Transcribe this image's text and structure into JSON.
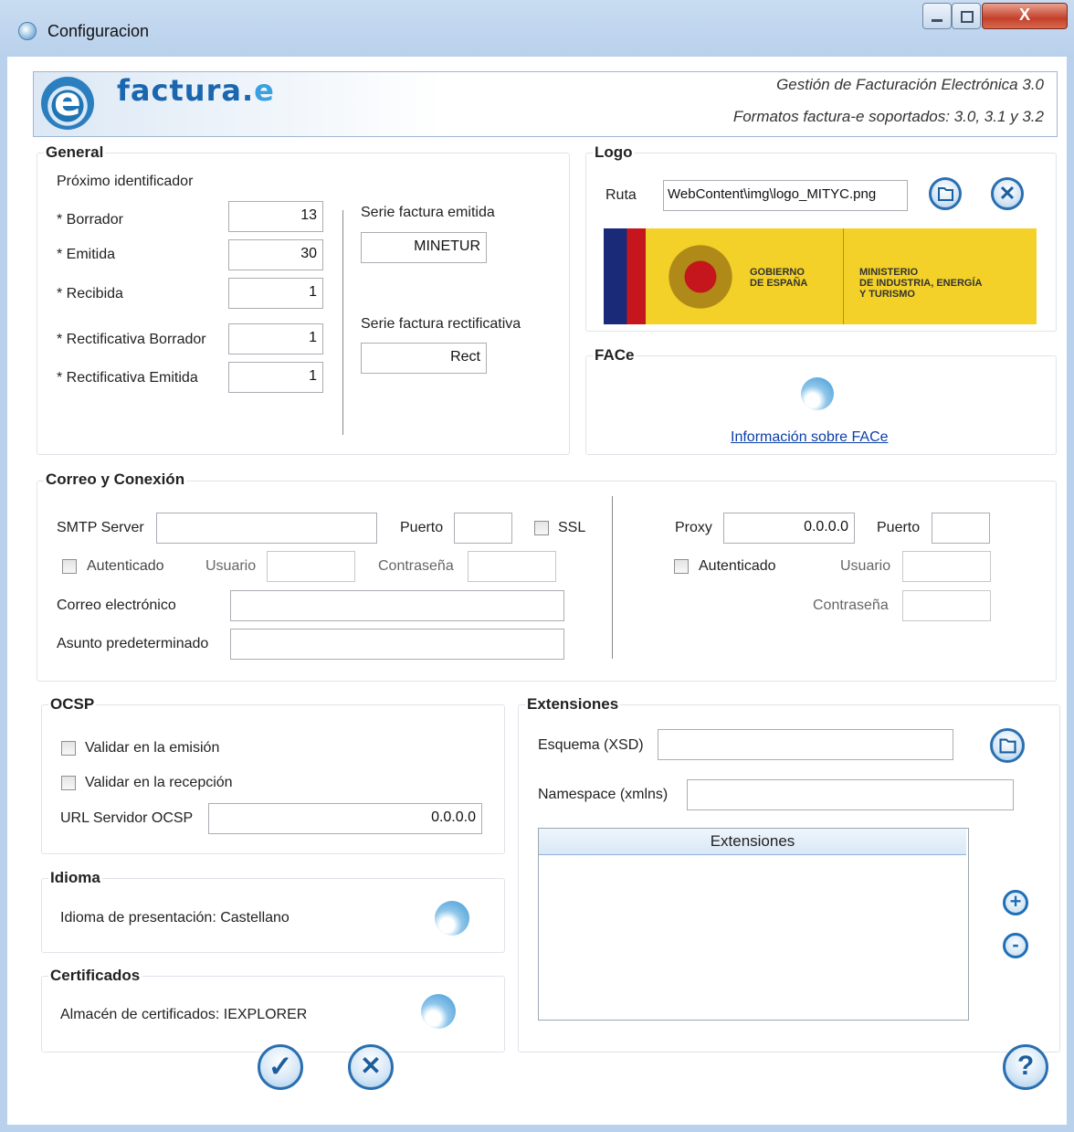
{
  "window": {
    "title": "Configuracion",
    "close_label": "X"
  },
  "header": {
    "brand_prefix": "factura.",
    "brand_suffix": "e",
    "line1": "Gestión de Facturación Electrónica 3.0",
    "line2": "Formatos factura-e soportados: 3.0, 3.1 y 3.2"
  },
  "general": {
    "title": "General",
    "next_id_label": "Próximo identificador",
    "borrador_label": "* Borrador",
    "borrador_value": "13",
    "emitida_label": "* Emitida",
    "emitida_value": "30",
    "recibida_label": "* Recibida",
    "recibida_value": "1",
    "rect_borrador_label": "* Rectificativa Borrador",
    "rect_borrador_value": "1",
    "rect_emitida_label": "* Rectificativa Emitida",
    "rect_emitida_value": "1",
    "serie_emitida_label": "Serie factura emitida",
    "serie_emitida_value": "MINETUR",
    "serie_rect_label": "Serie factura rectificativa",
    "serie_rect_value": "Rect"
  },
  "logo": {
    "title": "Logo",
    "ruta_label": "Ruta",
    "ruta_value": "WebContent\\img\\logo_MITYC.png",
    "gov_left_1": "GOBIERNO",
    "gov_left_2": "DE ESPAÑA",
    "gov_right_1": "MINISTERIO",
    "gov_right_2": "DE INDUSTRIA, ENERGÍA",
    "gov_right_3": "Y TURISMO"
  },
  "face": {
    "title": "FACe",
    "link": "Información sobre FACe"
  },
  "mail": {
    "title": "Correo y Conexión",
    "smtp_label": "SMTP Server",
    "smtp_value": "",
    "puerto_label": "Puerto",
    "puerto_value": "",
    "ssl_label": "SSL",
    "auth_label": "Autenticado",
    "usuario_label": "Usuario",
    "password_label": "Contraseña",
    "email_label": "Correo electrónico",
    "subject_label": "Asunto predeterminado",
    "proxy_label": "Proxy",
    "proxy_value": "0.0.0.0",
    "proxy_puerto_label": "Puerto",
    "proxy_auth_label": "Autenticado",
    "proxy_usuario_label": "Usuario",
    "proxy_password_label": "Contraseña"
  },
  "ocsp": {
    "title": "OCSP",
    "validate_emit_label": "Validar en la emisión",
    "validate_recv_label": "Validar en la recepción",
    "url_label": "URL Servidor OCSP",
    "url_value": "0.0.0.0"
  },
  "idioma": {
    "title": "Idioma",
    "label": "Idioma de presentación: Castellano"
  },
  "certificados": {
    "title": "Certificados",
    "label": "Almacén de certificados: IEXPLORER"
  },
  "extensiones": {
    "title": "Extensiones",
    "schema_label": "Esquema (XSD)",
    "namespace_label": "Namespace (xmlns)",
    "table_header": "Extensiones",
    "add_label": "+",
    "remove_label": "-"
  },
  "footer": {
    "ok_label": "✓",
    "cancel_label": "✕",
    "help_label": "?"
  }
}
